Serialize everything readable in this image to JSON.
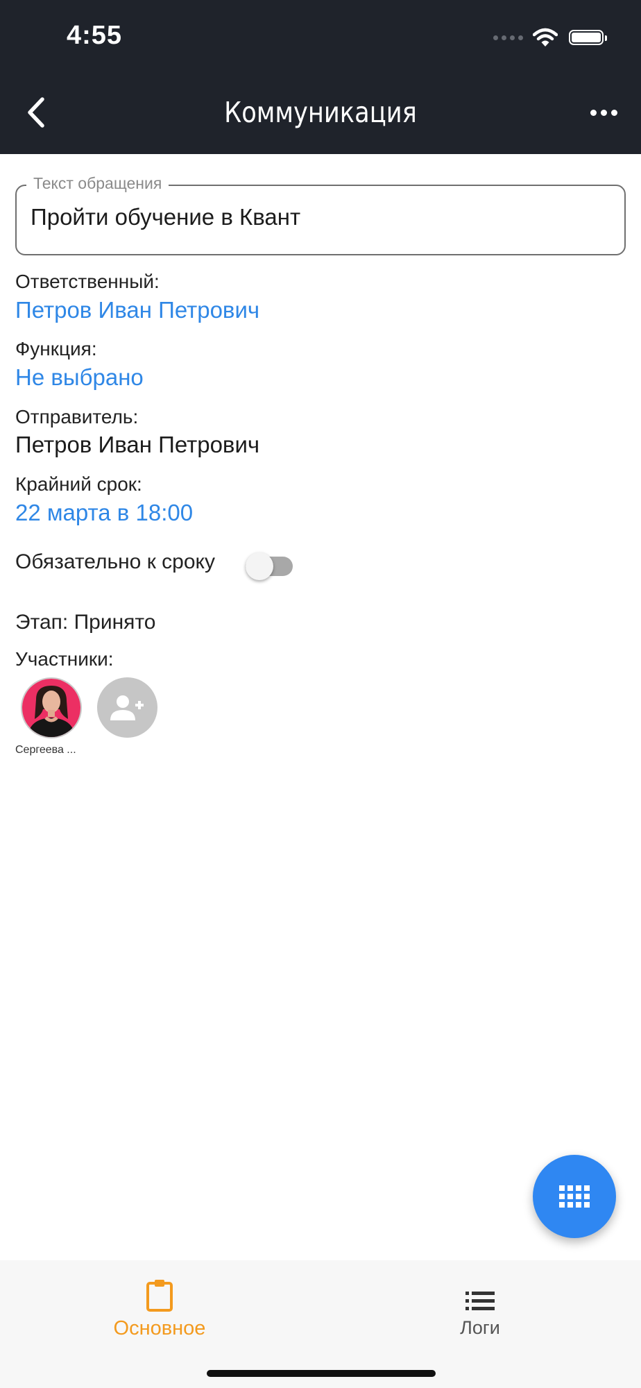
{
  "status_bar": {
    "time": "4:55"
  },
  "header": {
    "title": "Коммуникация"
  },
  "request_field": {
    "legend": "Текст обращения",
    "value": "Пройти обучение в Квант"
  },
  "responsible": {
    "label": "Ответственный:",
    "value": "Петров Иван Петрович"
  },
  "function": {
    "label": "Функция:",
    "value": "Не выбрано"
  },
  "sender": {
    "label": "Отправитель:",
    "value": "Петров Иван Петрович"
  },
  "deadline": {
    "label": "Крайний срок:",
    "value": "22 марта в 18:00"
  },
  "deadline_required": {
    "label": "Обязательно к сроку",
    "enabled": false
  },
  "stage": {
    "text": "Этап: Принято"
  },
  "participants": {
    "label": "Участники:",
    "members": [
      {
        "name": "Сергеева ..."
      }
    ]
  },
  "bottom_nav": {
    "tabs": [
      {
        "label": "Основное",
        "icon": "clipboard-icon",
        "active": true
      },
      {
        "label": "Логи",
        "icon": "list-icon",
        "active": false
      }
    ]
  },
  "colors": {
    "accent_link": "#2f87e6",
    "active_tab": "#f39a1e",
    "fab": "#2f87f2",
    "header_bg": "#1f232b"
  }
}
